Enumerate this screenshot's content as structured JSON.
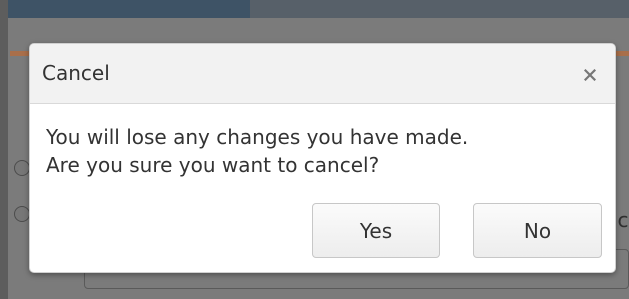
{
  "background": {
    "partial_text": "ic"
  },
  "dialog": {
    "title": "Cancel",
    "close_icon": "close-icon",
    "message_line_1": "You will lose any changes you have made.",
    "message_line_2": "Are you sure you want to cancel?",
    "buttons": {
      "yes_label": "Yes",
      "no_label": "No"
    },
    "colors": {
      "header_bg": "#f2f2f2",
      "dialog_bg": "#ffffff",
      "overlay_bg": "#7f7f7f",
      "accent": "#b86b3a"
    }
  }
}
